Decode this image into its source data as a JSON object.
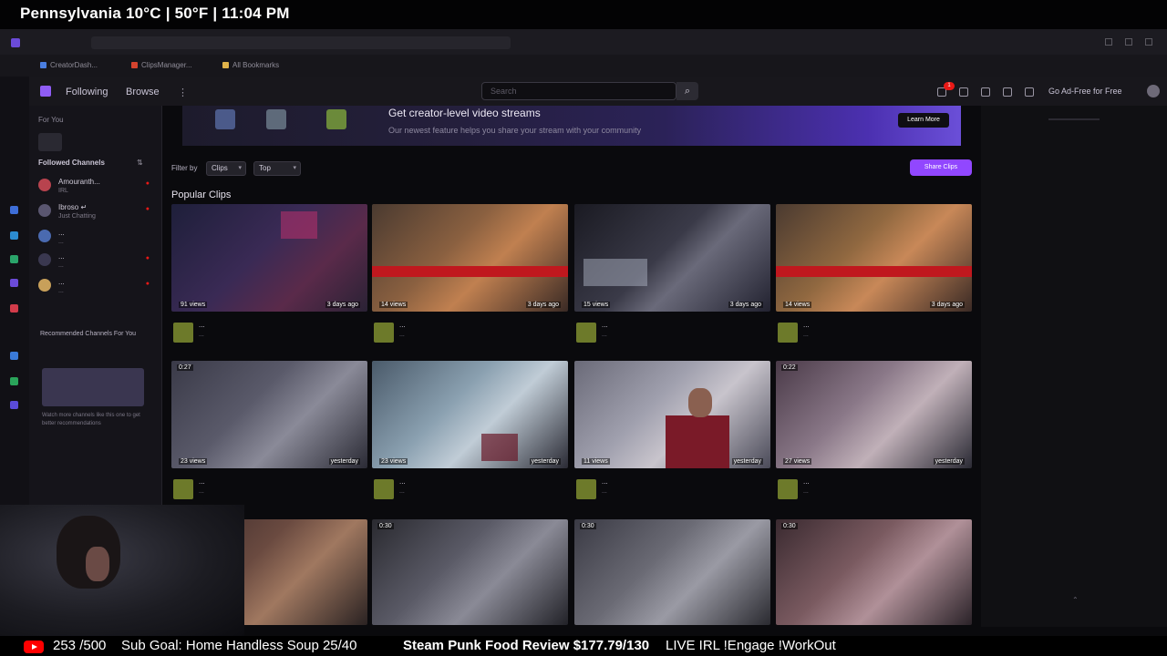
{
  "overlay": {
    "weather": "Pennsylvania 10°C | 50°F | 11:04 PM"
  },
  "browser": {
    "bookmarks": [
      "CreatorDash...",
      "ClipsManager...",
      "All Bookmarks"
    ]
  },
  "header": {
    "nav": [
      "Following",
      "Browse"
    ],
    "search_placeholder": "Search",
    "notification_count": "1",
    "ad_free": "Go Ad-Free for Free"
  },
  "sidebar": {
    "head": "For You",
    "section_label": "Followed Channels",
    "channels": [
      {
        "name": "Amouranth...",
        "sub": "IRL",
        "live": "●"
      },
      {
        "name": "Ibroso ↵",
        "sub": "Just Chatting",
        "live": "●"
      },
      {
        "name": "...",
        "sub": "...",
        "live": ""
      },
      {
        "name": "...",
        "sub": "...",
        "live": "●"
      },
      {
        "name": "...",
        "sub": "...",
        "live": "●"
      }
    ],
    "promo_title": "Recommended Channels For You",
    "promo_lines": "Watch more channels like this one to get better recommendations"
  },
  "banner": {
    "title": "Get creator-level video streams",
    "subtitle": "Our newest feature helps you share your stream with your community",
    "button": "Learn More"
  },
  "filter": {
    "label": "Filter by",
    "type": "Clips",
    "range": "Top",
    "share_button": "Share Clips"
  },
  "section_title": "Popular Clips",
  "clips": [
    {
      "views": "91 views",
      "date": "3 days ago",
      "dur": "",
      "title": "...",
      "sub": "..."
    },
    {
      "views": "14 views",
      "date": "3 days ago",
      "dur": "",
      "title": "...",
      "sub": "..."
    },
    {
      "views": "15 views",
      "date": "3 days ago",
      "dur": "",
      "title": "...",
      "sub": "..."
    },
    {
      "views": "14 views",
      "date": "3 days ago",
      "dur": "",
      "title": "...",
      "sub": "..."
    },
    {
      "views": "23 views",
      "date": "yesterday",
      "dur": "0:27",
      "title": "...",
      "sub": "..."
    },
    {
      "views": "23 views",
      "date": "yesterday",
      "dur": "",
      "title": "...",
      "sub": "..."
    },
    {
      "views": "11 views",
      "date": "yesterday",
      "dur": "",
      "title": "...",
      "sub": "..."
    },
    {
      "views": "27 views",
      "date": "yesterday",
      "dur": "0:22",
      "title": "...",
      "sub": "..."
    },
    {
      "views": "",
      "date": "",
      "dur": "",
      "title": "",
      "sub": ""
    },
    {
      "views": "",
      "date": "",
      "dur": "0:30",
      "title": "",
      "sub": ""
    },
    {
      "views": "",
      "date": "",
      "dur": "0:30",
      "title": "",
      "sub": ""
    },
    {
      "views": "",
      "date": "",
      "dur": "0:30",
      "title": "",
      "sub": ""
    }
  ],
  "ticker": {
    "count": "253 /500",
    "goal": "Sub Goal: Home Handless Soup 25/40",
    "review": "Steam Punk Food Review $177.79/130",
    "commands": "LIVE IRL !Engage !WorkOut"
  }
}
